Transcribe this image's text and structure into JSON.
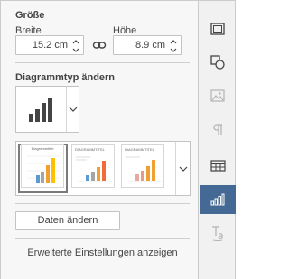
{
  "size": {
    "heading": "Größe",
    "width_label": "Breite",
    "height_label": "Höhe",
    "width_value": "15.2 cm",
    "height_value": "8.9 cm"
  },
  "chart_type": {
    "heading": "Diagrammtyp ändern"
  },
  "styles": {
    "thumbnails": [
      {
        "title": "Diagrammtitel",
        "selected": true
      },
      {
        "title": "DIAGRAMMTITEL",
        "selected": false
      },
      {
        "title": "DIAGRAMMTITEL",
        "selected": false
      }
    ]
  },
  "buttons": {
    "edit_data": "Daten ändern",
    "advanced": "Erweiterte Einstellungen anzeigen"
  },
  "rail": {
    "items": [
      {
        "icon": "slide-settings-icon",
        "active": false
      },
      {
        "icon": "shape-settings-icon",
        "active": false
      },
      {
        "icon": "image-settings-icon",
        "active": false
      },
      {
        "icon": "paragraph-settings-icon",
        "active": false
      },
      {
        "icon": "table-settings-icon",
        "active": false
      },
      {
        "icon": "chart-settings-icon",
        "active": true
      },
      {
        "icon": "text-art-settings-icon",
        "active": false
      }
    ]
  },
  "colors": {
    "accent": "#446995",
    "orange": "#f0a030",
    "yellow": "#ffc000",
    "blue": "#5b9bd5",
    "gray": "#a5a5a5"
  }
}
